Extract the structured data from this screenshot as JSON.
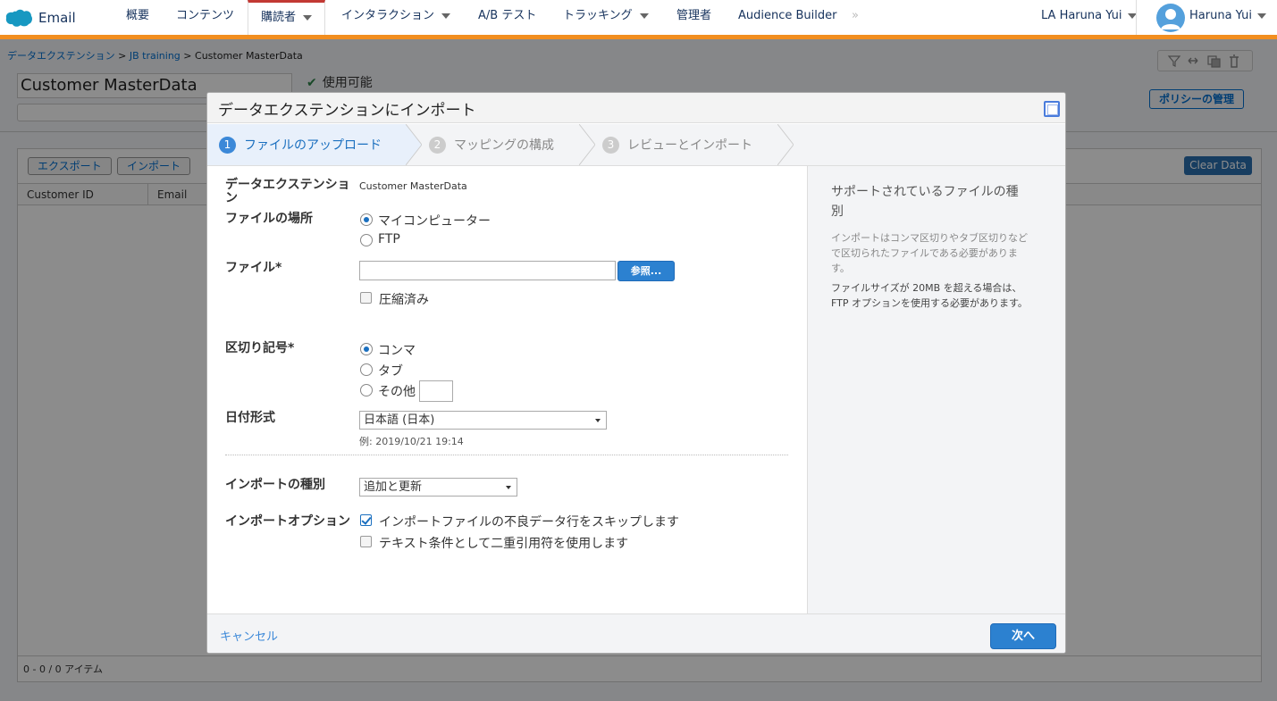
{
  "app": {
    "name": "Email"
  },
  "nav": {
    "items": [
      {
        "label": "概要",
        "caret": false
      },
      {
        "label": "コンテンツ",
        "caret": false
      },
      {
        "label": "購読者",
        "caret": true,
        "active": true
      },
      {
        "label": "インタラクション",
        "caret": true
      },
      {
        "label": "A/B テスト",
        "caret": false
      },
      {
        "label": "トラッキング",
        "caret": true
      },
      {
        "label": "管理者",
        "caret": false
      },
      {
        "label": "Audience Builder",
        "caret": false
      }
    ],
    "more": "»",
    "account": "LA Haruna Yui",
    "user": "Haruna Yui"
  },
  "page": {
    "breadcrumb": [
      {
        "label": "データエクステンション",
        "link": true
      },
      {
        "label": ">",
        "link": false
      },
      {
        "label": "JB training",
        "link": true
      },
      {
        "label": ">",
        "link": false
      },
      {
        "label": "Customer MasterData",
        "link": false
      }
    ],
    "title": "Customer MasterData",
    "status": "使用可能",
    "policy_button": "ポリシーの管理",
    "export_button": "エクスポート",
    "import_button": "インポート",
    "clear_button": "Clear Data",
    "columns": [
      "Customer ID",
      "Email"
    ],
    "pager": "0 - 0 / 0 アイテム"
  },
  "modal": {
    "title": "データエクステンションにインポート",
    "steps": [
      {
        "num": "1",
        "label": "ファイルのアップロード",
        "active": true
      },
      {
        "num": "2",
        "label": "マッピングの構成",
        "active": false
      },
      {
        "num": "3",
        "label": "レビューとインポート",
        "active": false
      }
    ],
    "form": {
      "de_label": "データエクステンション",
      "de_value": "Customer MasterData",
      "location_label": "ファイルの場所",
      "location_options": [
        {
          "label": "マイコンピューター",
          "selected": true
        },
        {
          "label": "FTP",
          "selected": false
        }
      ],
      "file_label": "ファイル*",
      "file_value": "",
      "browse_button": "参照...",
      "compressed_label": "圧縮済み",
      "compressed_checked": false,
      "delimiter_label": "区切り記号*",
      "delimiter_options": [
        {
          "label": "コンマ",
          "selected": true
        },
        {
          "label": "タブ",
          "selected": false
        },
        {
          "label": "その他",
          "selected": false
        }
      ],
      "other_value": "",
      "date_label": "日付形式",
      "date_value": "日本語 (日本)",
      "date_example": "例: 2019/10/21 19:14",
      "import_type_label": "インポートの種別",
      "import_type_value": "追加と更新",
      "options_label": "インポートオプション",
      "options": [
        {
          "label": "インポートファイルの不良データ行をスキップします",
          "checked": true
        },
        {
          "label": "テキスト条件として二重引用符を使用します",
          "checked": false
        }
      ]
    },
    "help": {
      "title": "サポートされているファイルの種別",
      "text1": "インポートはコンマ区切りやタブ区切りなどで区切られたファイルである必要があります。",
      "text2": "ファイルサイズが 20MB を超える場合は、FTP オプションを使用する必要があります。"
    },
    "cancel": "キャンセル",
    "next": "次へ"
  },
  "colors": {
    "accent": "#2c81d0",
    "nav_bar": "#f28e1f",
    "active_tab": "#c23934"
  }
}
